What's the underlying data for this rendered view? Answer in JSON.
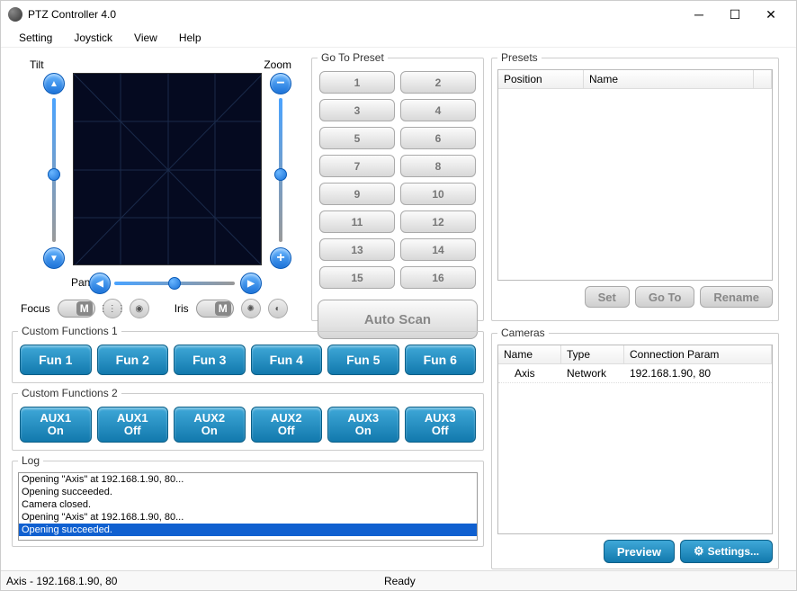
{
  "window": {
    "title": "PTZ Controller 4.0"
  },
  "menu": {
    "setting": "Setting",
    "joystick": "Joystick",
    "view": "View",
    "help": "Help"
  },
  "tilt_label": "Tilt",
  "zoom_label": "Zoom",
  "pan_label": "Pan",
  "focus_label": "Focus",
  "iris_label": "Iris",
  "toggle_M": "M",
  "goto_preset_legend": "Go To Preset",
  "auto_scan": "Auto Scan",
  "preset_btns": [
    "1",
    "2",
    "3",
    "4",
    "5",
    "6",
    "7",
    "8",
    "9",
    "10",
    "11",
    "12",
    "13",
    "14",
    "15",
    "16"
  ],
  "custom1_legend": "Custom Functions 1",
  "fun": [
    "Fun 1",
    "Fun 2",
    "Fun 3",
    "Fun 4",
    "Fun 5",
    "Fun 6"
  ],
  "custom2_legend": "Custom Functions 2",
  "aux": [
    "AUX1\nOn",
    "AUX1\nOff",
    "AUX2\nOn",
    "AUX2\nOff",
    "AUX3\nOn",
    "AUX3\nOff"
  ],
  "log_legend": "Log",
  "log_lines": [
    "Opening \"Axis\" at 192.168.1.90, 80...",
    "Opening succeeded.",
    "Camera closed.",
    "Opening \"Axis\" at 192.168.1.90, 80...",
    "Opening succeeded."
  ],
  "presets_legend": "Presets",
  "presets_cols": {
    "position": "Position",
    "name": "Name"
  },
  "preset_actions": {
    "set": "Set",
    "goto": "Go To",
    "rename": "Rename"
  },
  "cameras_legend": "Cameras",
  "cam_cols": {
    "name": "Name",
    "type": "Type",
    "conn": "Connection Param"
  },
  "cameras": [
    {
      "name": "Axis",
      "type": "Network",
      "conn": "192.168.1.90, 80"
    }
  ],
  "cam_actions": {
    "preview": "Preview",
    "settings": "Settings..."
  },
  "status": {
    "left": "Axis - 192.168.1.90, 80",
    "mid": "Ready"
  }
}
